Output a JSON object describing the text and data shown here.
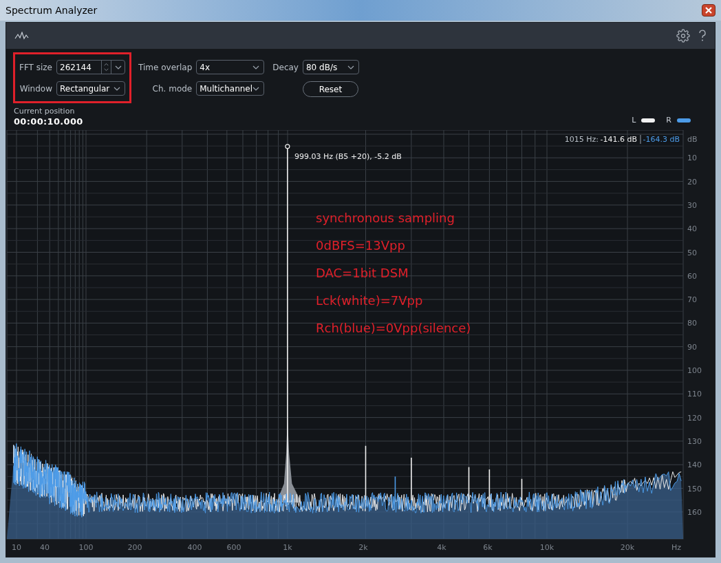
{
  "window": {
    "title": "Spectrum Analyzer"
  },
  "settings": [
    {
      "label": "FFT size",
      "value": "262144",
      "kind": "spin"
    },
    {
      "label": "Window",
      "value": "Rectangular",
      "kind": "select"
    },
    {
      "label": "Time overlap",
      "value": "4x",
      "kind": "select"
    },
    {
      "label": "Ch. mode",
      "value": "Multichannel",
      "kind": "select"
    },
    {
      "label": "Decay",
      "value": "80 dB/s",
      "kind": "select"
    }
  ],
  "reset_button": "Reset",
  "position": {
    "label": "Current position",
    "value": "00:00:10.000"
  },
  "legend": [
    {
      "label": "L",
      "color": "#f0f0f0"
    },
    {
      "label": "R",
      "color": "#4c9be8"
    }
  ],
  "readout": {
    "frequency": "1015 Hz:",
    "left": "-141.6 dB",
    "right": "-164.3 dB"
  },
  "peak_label": "999.03 Hz (B5 +20), -5.2 dB",
  "annotations": [
    "synchronous sampling",
    "0dBFS=13Vpp",
    "DAC=1bit DSM",
    "Lck(white)=7Vpp",
    "Rch(blue)=0Vpp(silence)"
  ],
  "y_axis": [
    "dB",
    "10",
    "20",
    "30",
    "40",
    "50",
    "60",
    "70",
    "80",
    "90",
    "100",
    "110",
    "120",
    "130",
    "140",
    "150",
    "160"
  ],
  "x_axis": [
    "10",
    "40",
    "100",
    "200",
    "400",
    "600",
    "1k",
    "2k",
    "4k",
    "6k",
    "10k",
    "20k",
    "Hz"
  ]
}
